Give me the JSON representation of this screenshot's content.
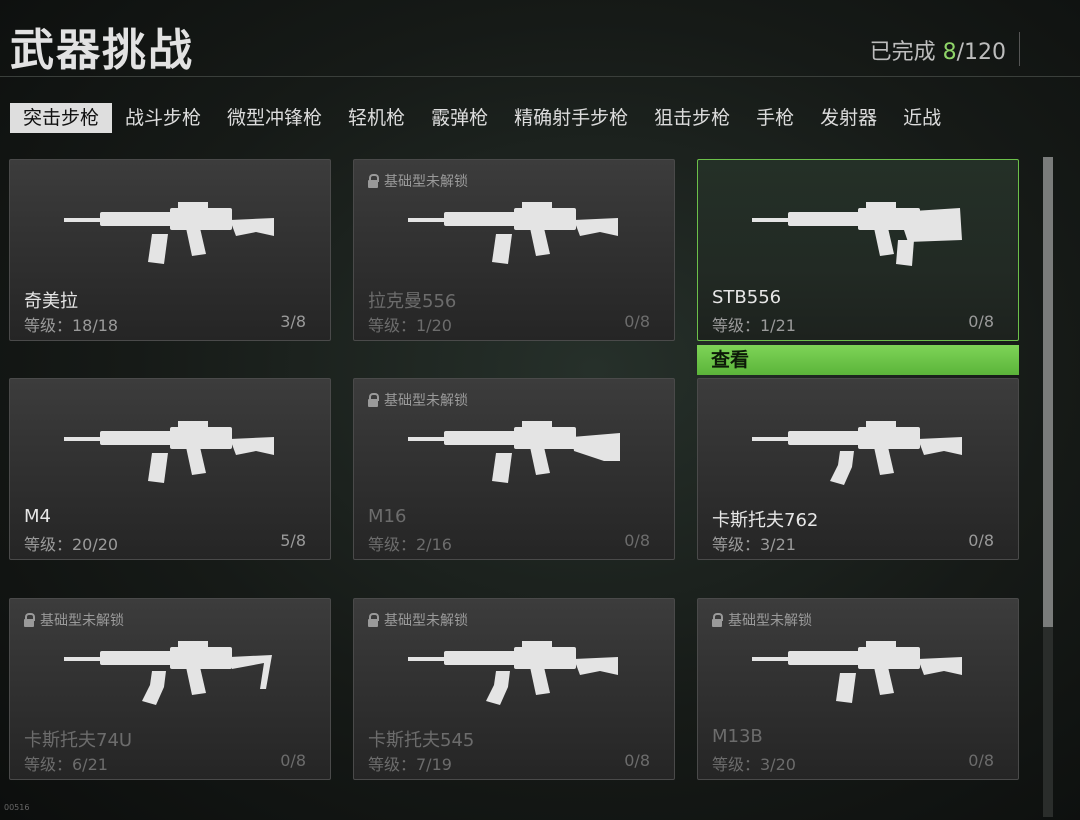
{
  "header": {
    "title": "武器挑战",
    "progress_label": "已完成",
    "progress_done": "8",
    "progress_total": "/120"
  },
  "tabs": [
    "突击步枪",
    "战斗步枪",
    "微型冲锋枪",
    "轻机枪",
    "霰弹枪",
    "精确射手步枪",
    "狙击步枪",
    "手枪",
    "发射器",
    "近战"
  ],
  "active_tab": "突击步枪",
  "lock_label": "基础型未解锁",
  "view_button": "查看",
  "corner_tag": "00516",
  "weapons": [
    {
      "name": "奇美拉",
      "level": "等级：18/18",
      "count": "3/8",
      "locked": false,
      "selected": false,
      "gun_icon": "compact-rifle-icon"
    },
    {
      "name": "拉克曼556",
      "level": "等级：1/20",
      "count": "0/8",
      "locked": true,
      "selected": false,
      "gun_icon": "rifle-icon"
    },
    {
      "name": "STB556",
      "level": "等级：1/21",
      "count": "0/8",
      "locked": false,
      "selected": true,
      "gun_icon": "bullpup-rifle-icon"
    },
    {
      "name": "M4",
      "level": "等级：20/20",
      "count": "5/8",
      "locked": false,
      "selected": false,
      "gun_icon": "m4-rifle-icon"
    },
    {
      "name": "M16",
      "level": "等级：2/16",
      "count": "0/8",
      "locked": true,
      "selected": false,
      "gun_icon": "m16-rifle-icon"
    },
    {
      "name": "卡斯托夫762",
      "level": "等级：3/21",
      "count": "0/8",
      "locked": false,
      "selected": false,
      "gun_icon": "ak-rifle-icon"
    },
    {
      "name": "卡斯托夫74U",
      "level": "等级：6/21",
      "count": "0/8",
      "locked": true,
      "selected": false,
      "gun_icon": "ak-short-rifle-icon"
    },
    {
      "name": "卡斯托夫545",
      "level": "等级：7/19",
      "count": "0/8",
      "locked": true,
      "selected": false,
      "gun_icon": "ak-rifle-icon"
    },
    {
      "name": "M13B",
      "level": "等级：3/20",
      "count": "0/8",
      "locked": true,
      "selected": false,
      "gun_icon": "compact-rifle-icon"
    }
  ]
}
